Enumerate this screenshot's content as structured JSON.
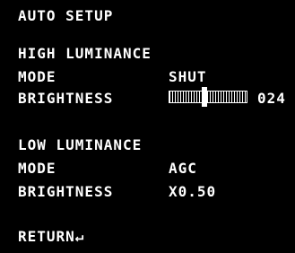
{
  "title": "AUTO SETUP",
  "high": {
    "header": "HIGH LUMINANCE",
    "mode_label": "MODE",
    "mode_value": "SHUT",
    "brightness_label": "BRIGHTNESS",
    "brightness_value": "024",
    "brightness_level": 0.45
  },
  "low": {
    "header": "LOW LUMINANCE",
    "mode_label": "MODE",
    "mode_value": "AGC",
    "brightness_label": "BRIGHTNESS",
    "brightness_value": "X0.50"
  },
  "return_label": "RETURN↵"
}
